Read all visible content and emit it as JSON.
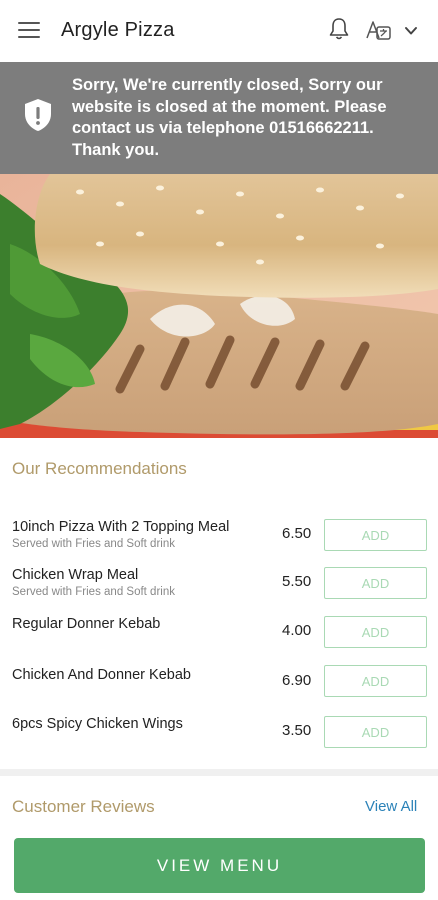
{
  "header": {
    "title": "Argyle Pizza",
    "icons": [
      "menu-icon",
      "bell-icon",
      "language-icon",
      "chevron-down-icon"
    ]
  },
  "notice": {
    "message": "Sorry, We're currently closed, Sorry our website is closed at the moment. Please contact us via telephone 01516662211. Thank you.",
    "icon": "shield-alert-icon",
    "background": "#7d7d7d"
  },
  "recommendations": {
    "title": "Our Recommendations",
    "items": [
      {
        "name": "10inch Pizza With 2 Topping Meal",
        "description": "Served with Fries and Soft drink",
        "price": "6.50",
        "add_label": "ADD"
      },
      {
        "name": "Chicken Wrap Meal",
        "description": "Served with Fries and Soft drink",
        "price": "5.50",
        "add_label": "ADD"
      },
      {
        "name": "Regular Donner Kebab",
        "description": "",
        "price": "4.00",
        "add_label": "ADD"
      },
      {
        "name": "Chicken And Donner Kebab",
        "description": "",
        "price": "6.90",
        "add_label": "ADD"
      },
      {
        "name": "6pcs Spicy Chicken Wings",
        "description": "",
        "price": "3.50",
        "add_label": "ADD"
      }
    ]
  },
  "reviews": {
    "title": "Customer Reviews",
    "view_all": "View All"
  },
  "cta": {
    "label": "VIEW MENU",
    "color": "#53a96a"
  },
  "colors": {
    "section_title": "#b09a6a",
    "link": "#2b82b8",
    "add_border": "#a9d9b4"
  }
}
